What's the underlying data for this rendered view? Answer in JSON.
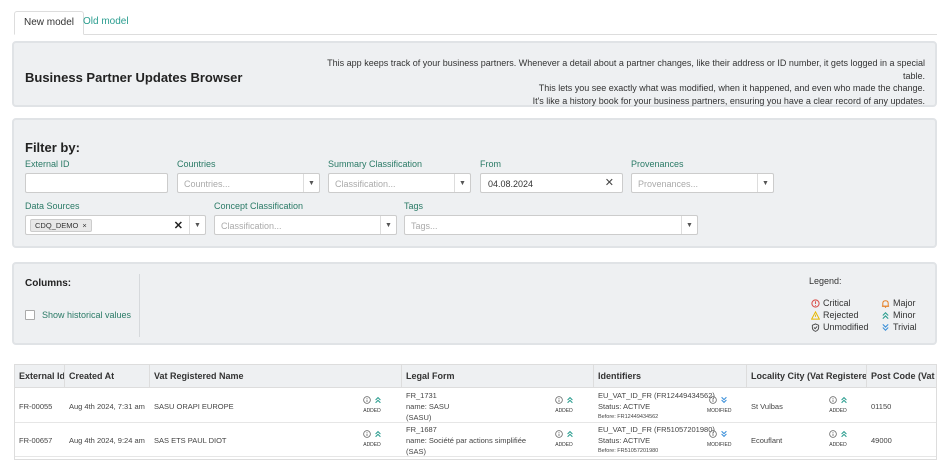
{
  "tabs": [
    {
      "label": "New model",
      "active": true
    },
    {
      "label": "Old model",
      "active": false
    }
  ],
  "header": {
    "title": "Business Partner Updates Browser",
    "description": [
      "This app keeps track of your business partners. Whenever a detail about a partner changes, like their address or ID number, it gets logged in a special table.",
      "This lets you see exactly what was modified, when it happened, and even who made the change.",
      "It's like a history book for your business partners, ensuring you have a clear record of any updates."
    ]
  },
  "filter": {
    "title": "Filter by:",
    "external_id": {
      "label": "External ID",
      "value": ""
    },
    "countries": {
      "label": "Countries",
      "placeholder": "Countries..."
    },
    "summary_classification": {
      "label": "Summary Classification",
      "placeholder": "Classification..."
    },
    "from": {
      "label": "From",
      "value": "04.08.2024"
    },
    "provenances": {
      "label": "Provenances",
      "placeholder": "Provenances..."
    },
    "data_sources": {
      "label": "Data Sources",
      "chip": "CDQ_DEMO"
    },
    "concept_classification": {
      "label": "Concept Classification",
      "placeholder": "Classification..."
    },
    "tags": {
      "label": "Tags",
      "placeholder": "Tags..."
    }
  },
  "columns": {
    "title": "Columns:",
    "show_historical_label": "Show historical values",
    "show_historical_checked": false
  },
  "legend": {
    "title": "Legend:",
    "items": [
      {
        "label": "Critical",
        "icon": "critical-icon",
        "color": "#d9534f"
      },
      {
        "label": "Major",
        "icon": "bell-icon",
        "color": "#e67e22"
      },
      {
        "label": "Rejected",
        "icon": "warning-icon",
        "color": "#e6b800"
      },
      {
        "label": "Minor",
        "icon": "double-chevron-up-icon",
        "color": "#2a9d8f"
      },
      {
        "label": "Unmodified",
        "icon": "shield-check-icon",
        "color": "#444444"
      },
      {
        "label": "Trivial",
        "icon": "double-chevron-down-icon",
        "color": "#3a8fd9"
      }
    ]
  },
  "table": {
    "headers": [
      "External Id",
      "Created At",
      "Vat Registered Name",
      "Legal Form",
      "Identifiers",
      "Locality City (Vat Registered)",
      "Post Code (Vat R"
    ],
    "rows": [
      {
        "external_id": "FR-00055",
        "created_at": "Aug 4th 2024, 7:31 am",
        "vat_name": "SASU ORAPI EUROPE",
        "vat_status": "ADDED",
        "legal_form": [
          "FR_1731",
          "name: SASU",
          "(SASU)"
        ],
        "legal_status": "ADDED",
        "identifiers": [
          "EU_VAT_ID_FR (FR12449434562)",
          "Status: ACTIVE"
        ],
        "identifiers_before": "Before: FR12449434562",
        "identifiers_status": "MODIFIED",
        "locality": "St Vulbas",
        "locality_status": "ADDED",
        "post_code": "01150"
      },
      {
        "external_id": "FR-00657",
        "created_at": "Aug 4th 2024, 9:24 am",
        "vat_name": "SAS ETS PAUL DIOT",
        "vat_status": "ADDED",
        "legal_form": [
          "FR_1687",
          "name: Société par actions simplifiée",
          "(SAS)"
        ],
        "legal_status": "ADDED",
        "identifiers": [
          "EU_VAT_ID_FR (FR51057201980)",
          "Status: ACTIVE"
        ],
        "identifiers_before": "Before: FR51057201980",
        "identifiers_status": "MODIFIED",
        "locality": "Ecouflant",
        "locality_status": "ADDED",
        "post_code": "49000"
      }
    ]
  }
}
